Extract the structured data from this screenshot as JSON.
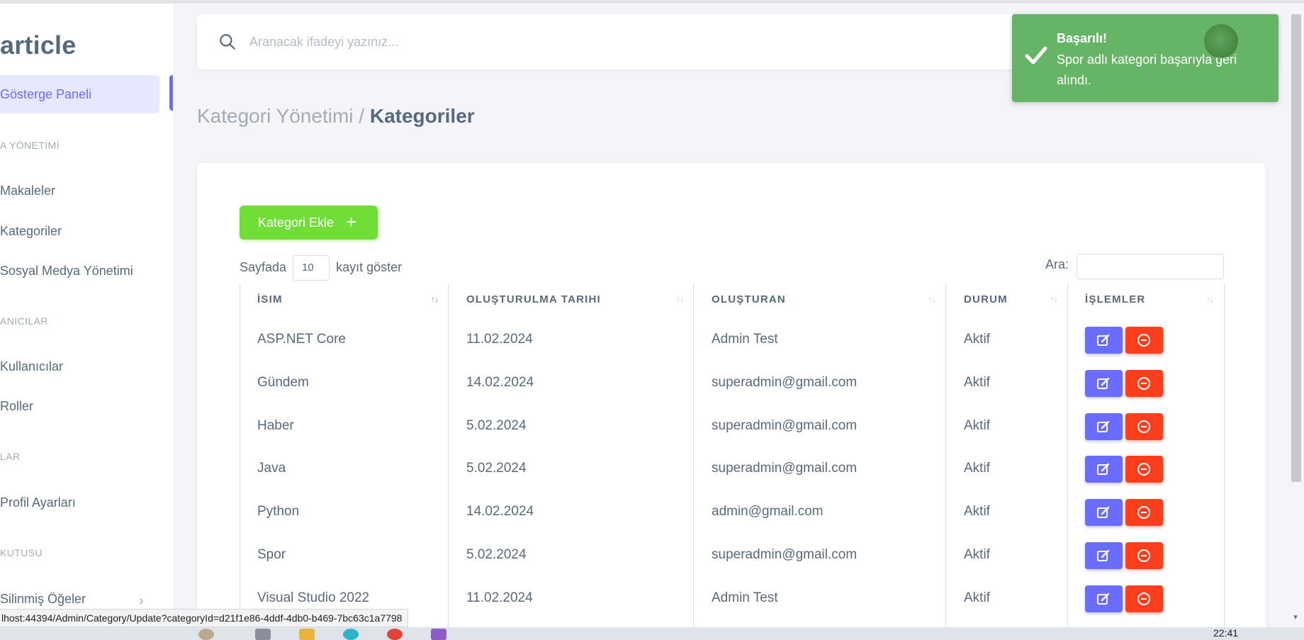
{
  "sidebar": {
    "brand": "article",
    "active_item": "Gösterge Paneli",
    "headers": [
      "A YÖNETİMİ",
      "ANICILAR",
      "LAR",
      "KUTUSU"
    ],
    "items": [
      "Makaleler",
      "Kategoriler",
      "Sosyal Medya Yönetimi",
      "Kullanıcılar",
      "Roller",
      "Profil Ayarları",
      "Silinmiş Öğeler"
    ]
  },
  "search": {
    "placeholder": "Aranacak ifadeyi yazınız..."
  },
  "breadcrumb": {
    "parent": "Kategori Yönetimi / ",
    "current": "Kategoriler"
  },
  "card": {
    "add_button": "Kategori Ekle",
    "length_prefix": "Sayfada",
    "length_value": "10",
    "length_suffix": "kayıt göster",
    "search_label": "Ara:"
  },
  "table": {
    "headers": [
      "İSIM",
      "OLUŞTURULMA TARIHI",
      "OLUŞTURAN",
      "DURUM",
      "İŞLEMLER"
    ],
    "rows": [
      {
        "name": "ASP.NET Core",
        "date": "11.02.2024",
        "creator": "Admin Test",
        "status": "Aktif"
      },
      {
        "name": "Gündem",
        "date": "14.02.2024",
        "creator": "superadmin@gmail.com",
        "status": "Aktif"
      },
      {
        "name": "Haber",
        "date": "5.02.2024",
        "creator": "superadmin@gmail.com",
        "status": "Aktif"
      },
      {
        "name": "Java",
        "date": "5.02.2024",
        "creator": "superadmin@gmail.com",
        "status": "Aktif"
      },
      {
        "name": "Python",
        "date": "14.02.2024",
        "creator": "admin@gmail.com",
        "status": "Aktif"
      },
      {
        "name": "Spor",
        "date": "5.02.2024",
        "creator": "superadmin@gmail.com",
        "status": "Aktif"
      },
      {
        "name": "Visual Studio 2022",
        "date": "11.02.2024",
        "creator": "Admin Test",
        "status": "Aktif"
      }
    ]
  },
  "toast": {
    "title": "Başarılı!",
    "message": "Spor adlı kategori başarıyla geri alındı."
  },
  "status_url": "lhost:44394/Admin/Category/Update?categoryId=d21f1e86-4ddf-4db0-b469-7bc63c1a7798",
  "taskbar": {
    "clock": "22:41"
  },
  "colors": {
    "primary": "#696cff",
    "success": "#71dd37",
    "danger": "#ff3e1d",
    "toast": "#66b466"
  }
}
